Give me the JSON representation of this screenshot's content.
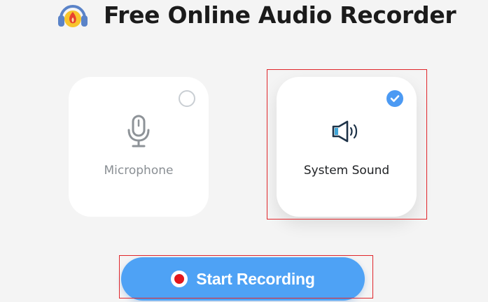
{
  "app": {
    "title": "Free Online Audio Recorder",
    "logo_icon": "headphones-logo-icon"
  },
  "sources": [
    {
      "id": "microphone",
      "label": "Microphone",
      "icon": "microphone-icon",
      "selected": false
    },
    {
      "id": "system-sound",
      "label": "System Sound",
      "icon": "speaker-icon",
      "selected": true
    }
  ],
  "start_button": {
    "label": "Start Recording",
    "icon": "record-icon"
  },
  "colors": {
    "accent": "#4ea2f5",
    "check": "#4c9af3",
    "record_red": "#e3161d",
    "highlight_red": "#e0262b",
    "background": "#f4f4f4"
  }
}
